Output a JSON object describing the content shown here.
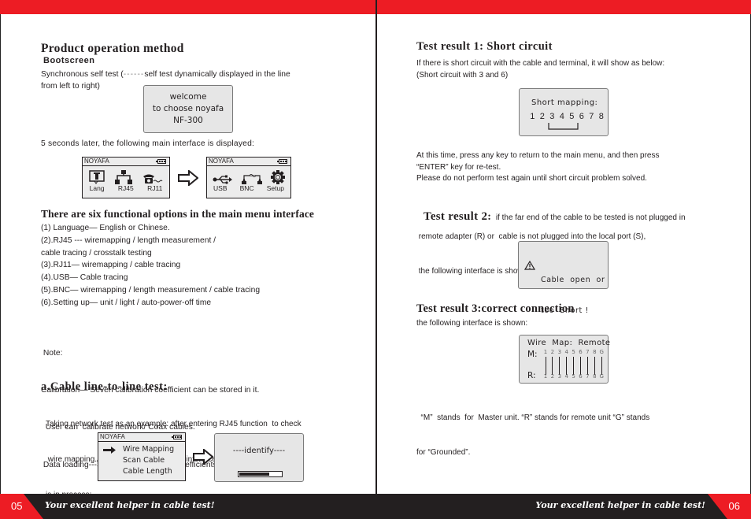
{
  "left_page": {
    "page_number": "05",
    "slogan": "Your excellent helper in cable test!",
    "title": "Product operation method",
    "bootscreen": {
      "subtitle": "Bootscreen",
      "desc_line1_pre": "Synchronous self test (",
      "desc_line1_dashes": "------",
      "desc_line1_post": "self test dynamically displayed in the line",
      "desc_line2": "from left to right)",
      "screen_lines": [
        "welcome",
        "to choose noyafa",
        "NF-300"
      ]
    },
    "main_interface_intro": "5 seconds later, the following main interface is displayed:",
    "main_screens": [
      {
        "brand": "NOYAFA",
        "items": [
          {
            "icon": "language-icon",
            "label": "Lang"
          },
          {
            "icon": "network-icon",
            "label": "RJ45"
          },
          {
            "icon": "telephone-icon",
            "label": "RJ11"
          }
        ]
      },
      {
        "brand": "NOYAFA",
        "items": [
          {
            "icon": "usb-icon",
            "label": "USB"
          },
          {
            "icon": "bnc-icon",
            "label": "BNC"
          },
          {
            "icon": "gear-icon",
            "label": "Setup"
          }
        ]
      }
    ],
    "options_heading": "There are six functional options in the main menu interface",
    "options": [
      "(1) Language— English or Chinese.",
      "(2).RJ45 --- wiremapping / length measurement /",
      "cable tracing / crosstalk testing",
      "(3).RJ11—  wiremapping / cable tracing",
      "(4).USB— Cable tracing",
      "(5).BNC— wiremapping / length measurement / cable tracing",
      "(6).Setting up— unit / light / auto-power-off time"
    ],
    "note": {
      "label": " Note:",
      "lines": [
        "Calibration— Seven calibration coefficient can be stored in it.",
        "  User can  calibrate network/ Coax cables.",
        " Data loading---Select  the calibration coefficients  stored in system."
      ]
    },
    "cable_test": {
      "heading": "a.Cable line-to-line test:",
      "lines": [
        "Taking network test as an example: after entering RJ45 function  to check",
        " wire mapping.At this time, the following interface is shown indicating test",
        "is in process:"
      ],
      "menu_screen": {
        "brand": "NOYAFA",
        "items": [
          "Wire Mapping",
          "Scan Cable",
          "Cable Length"
        ],
        "selected_index": 0
      },
      "identify_screen": {
        "text": "----identify----",
        "progress_fraction": 0.72
      }
    }
  },
  "right_page": {
    "page_number": "06",
    "slogan": "Your excellent helper in cable test!",
    "result1": {
      "heading": "Test result 1: Short circuit",
      "lines": [
        "If there is short circuit with the cable and terminal, it will show as below:",
        "(Short circuit with 3 and 6)"
      ],
      "screen_title": "Short  mapping:",
      "pins": [
        "1",
        "2",
        "3",
        "4",
        "5",
        "6",
        "7",
        "8"
      ],
      "shorted_pins": [
        "3",
        "6"
      ],
      "after_lines": [
        "At this time, press any key to return to the main menu, and then press",
        "“ENTER” key for re-test.",
        "Please do not perform test again until short circuit problem solved."
      ]
    },
    "result2": {
      "heading": "Test result 2",
      "heading_suffix": ":",
      "inline": "  if the far end of the cable to be tested is not plugged in",
      "lines": [
        " remote adapter (R) or  cable is not plugged into the local port (S),",
        " the following interface is shown:"
      ],
      "screen_lines": [
        "Cable  open  or",
        "too  Short !"
      ]
    },
    "result3": {
      "heading": "Test result 3:correct connection",
      "intro": "the following interface is shown:",
      "screen_title": "Wire  Map:  Remote",
      "m_label": "M:",
      "r_label": "R:",
      "pins": [
        "1",
        "2",
        "3",
        "4",
        "5",
        "6",
        "7",
        "8",
        "G"
      ],
      "explain_lines": [
        "  “M”  stands  for  Master unit. “R” stands for remote unit “G” stands",
        "for “Grounded”."
      ]
    }
  }
}
